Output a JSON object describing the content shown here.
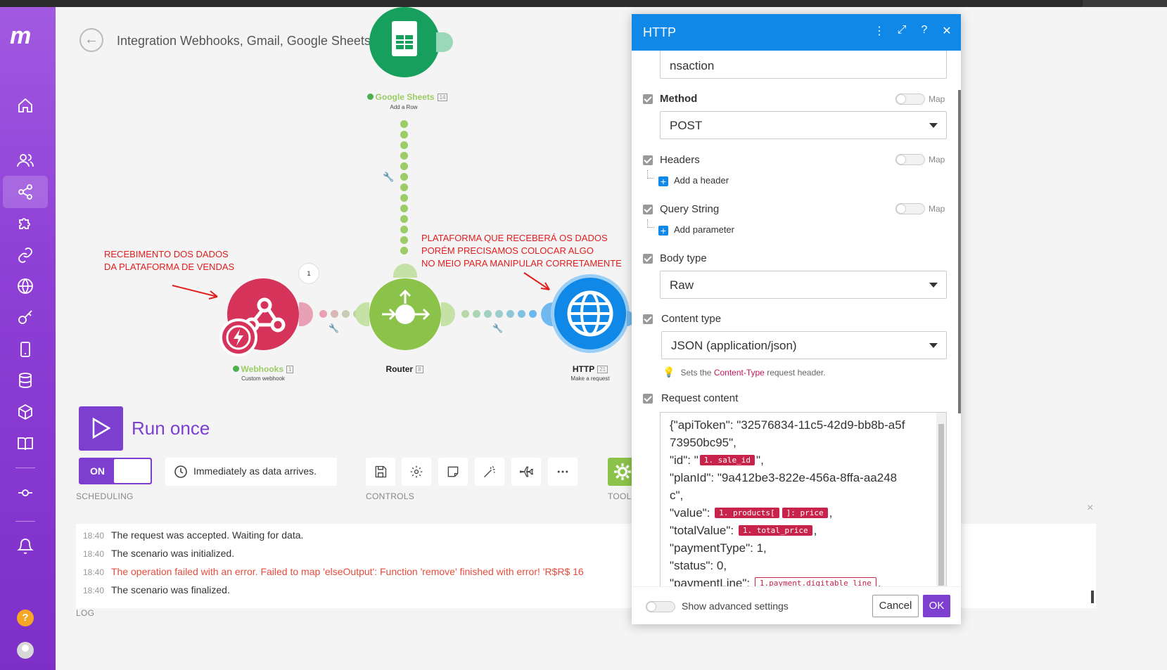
{
  "scenario": {
    "title": "Integration Webhooks, Gmail, Google Sheets"
  },
  "nodes": {
    "sheets": {
      "label": "Google Sheets",
      "badge": "14",
      "sub": "Add a Row"
    },
    "webhooks": {
      "label": "Webhooks",
      "badge": "1",
      "sub": "Custom webhook",
      "bubble": "1"
    },
    "router": {
      "label": "Router",
      "badge": "8"
    },
    "http": {
      "label": "HTTP",
      "badge": "21",
      "sub": "Make a request"
    }
  },
  "annotations": {
    "left": [
      "RECEBIMENTO DOS DADOS",
      "DA PLATAFORMA DE VENDAS"
    ],
    "right": [
      "PLATAFORMA QUE RECEBERÁ OS DADOS",
      "PORÉM PRECISAMOS COLOCAR ALGO",
      "NO MEIO PARA MANIPULAR CORRETAMENTE"
    ]
  },
  "controls": {
    "run_once": "Run once",
    "toggle_on": "ON",
    "schedule_text": "Immediately as data arrives.",
    "scheduling_caption": "SCHEDULING",
    "controls_caption": "CONTROLS",
    "tools_caption": "TOOL",
    "log_caption": "LOG"
  },
  "log": [
    {
      "time": "18:40",
      "message": "The request was accepted. Waiting for data.",
      "error": false
    },
    {
      "time": "18:40",
      "message": "The scenario was initialized.",
      "error": false
    },
    {
      "time": "18:40",
      "message": "The operation failed with an error. Failed to map 'elseOutput': Function 'remove' finished with error! 'R$R$ 16",
      "error": true
    },
    {
      "time": "18:40",
      "message": "The scenario was finalized.",
      "error": false
    }
  ],
  "dialog": {
    "title": "HTTP",
    "url_tail": "nsaction",
    "method_label": "Method",
    "method_value": "POST",
    "map_label": "Map",
    "headers_label": "Headers",
    "add_header": "Add a header",
    "query_label": "Query String",
    "add_parameter": "Add parameter",
    "body_type_label": "Body type",
    "body_type_value": "Raw",
    "content_type_label": "Content type",
    "content_type_value": "JSON (application/json)",
    "hint_pre": "Sets the",
    "hint_highlight": "Content-Type",
    "hint_post": "request header.",
    "request_content_label": "Request content",
    "code": {
      "l1": "{\"apiToken\": \"32576834-11c5-42d9-bb8b-a5f",
      "l2": "73950bc95\",",
      "id_pre": "\"id\": \"",
      "id_pill": "1. sale_id",
      "id_post": "\",",
      "plan1": "\"planId\": \"9a412be3-822e-456a-8ffa-aa248",
      "plan2": "c\",",
      "value_pre": "\"value\":",
      "value_pill1": "1. products[",
      "value_pill2": "]: price",
      "value_post": ",",
      "total_pre": "\"totalValue\":",
      "total_pill": "1. total_price",
      "total_post": ",",
      "payment_type": "\"paymentType\": 1,",
      "status": "\"status\": 0,",
      "payline_pre": "\"paymentLine\":",
      "payline_pill": "1.payment.digitable_line",
      "payline_post": ","
    },
    "advanced_label": "Show advanced settings",
    "cancel": "Cancel",
    "ok": "OK"
  },
  "colors": {
    "brand_purple": "#7c3fcf",
    "http_blue": "#0f88e8",
    "sheets_green": "#17a05d",
    "router_green": "#8bc34a",
    "webhooks_red": "#d6335b",
    "error_red": "#e74c3c"
  }
}
